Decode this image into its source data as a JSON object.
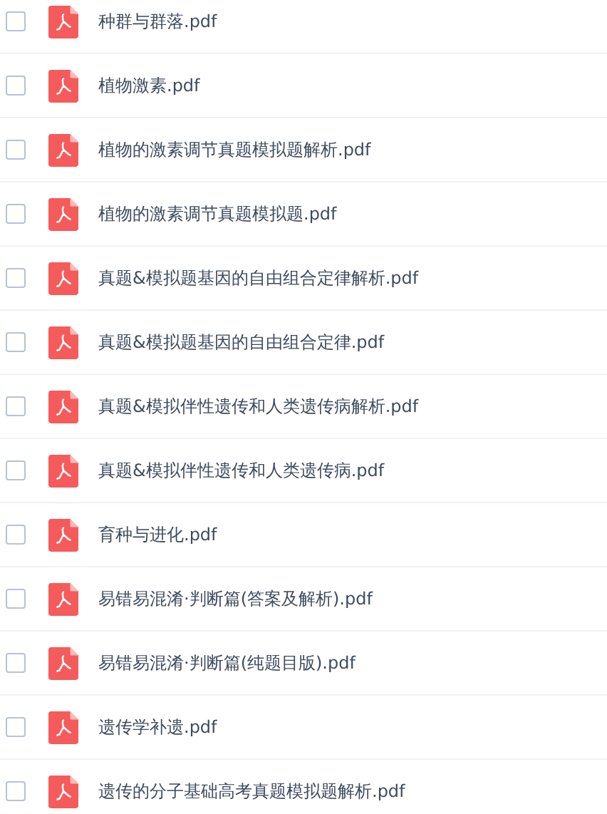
{
  "files": [
    {
      "name": "种群与群落.pdf",
      "checked": false
    },
    {
      "name": "植物激素.pdf",
      "checked": false
    },
    {
      "name": "植物的激素调节真题模拟题解析.pdf",
      "checked": false
    },
    {
      "name": "植物的激素调节真题模拟题.pdf",
      "checked": false
    },
    {
      "name": "真题&模拟题基因的自由组合定律解析.pdf",
      "checked": false
    },
    {
      "name": "真题&模拟题基因的自由组合定律.pdf",
      "checked": false
    },
    {
      "name": "真题&模拟伴性遗传和人类遗传病解析.pdf",
      "checked": false
    },
    {
      "name": "真题&模拟伴性遗传和人类遗传病.pdf",
      "checked": false
    },
    {
      "name": "育种与进化.pdf",
      "checked": false
    },
    {
      "name": "易错易混淆·判断篇(答案及解析).pdf",
      "checked": false
    },
    {
      "name": "易错易混淆·判断篇(纯题目版).pdf",
      "checked": false
    },
    {
      "name": "遗传学补遗.pdf",
      "checked": false
    },
    {
      "name": "遗传的分子基础高考真题模拟题解析.pdf",
      "checked": false
    }
  ]
}
